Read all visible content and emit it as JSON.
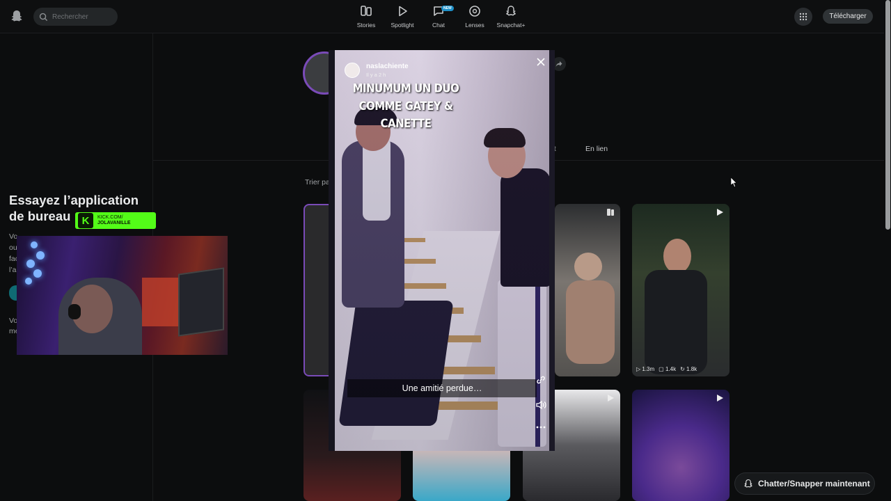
{
  "topbar": {
    "search_placeholder": "Rechercher",
    "nav": [
      {
        "label": "Stories",
        "icon": "stories-icon"
      },
      {
        "label": "Spotlight",
        "icon": "spotlight-play-icon"
      },
      {
        "label": "Chat",
        "icon": "chat-icon",
        "badge": "NEW"
      },
      {
        "label": "Lenses",
        "icon": "lenses-icon"
      },
      {
        "label": "Snapchat+",
        "icon": "snapchat-plus-icon"
      }
    ],
    "download_label": "Télécharger"
  },
  "left_panel": {
    "promo_title": "Essayez l’application de bureau",
    "promo_fragments": [
      "Vo",
      "ou",
      "fac",
      "l’a",
      "Vo",
      "me"
    ]
  },
  "stream_overlay": {
    "kick_line1": "KICK.COM/",
    "kick_line2": "JOLAVANILLE"
  },
  "profile": {
    "tab_fragment": "nt",
    "tab_link": "En lien",
    "sort_label": "Trier pa"
  },
  "tiles": [
    {
      "views": "1.3m",
      "comments": "1.4k",
      "shares": "1.8k"
    }
  ],
  "story": {
    "username": "naslachiente",
    "time": "Il y a 2 h",
    "caption": "MINUMUM UN DUO\nCOMME GATEY & CANETTE",
    "subtitle": "Une amitié perdue…"
  },
  "chat_now_label": "Chatter/Snapper maintenant",
  "colors": {
    "background": "#0c0d0e",
    "kick_green": "#53fc18",
    "story_ring": "#7a4bb8"
  }
}
